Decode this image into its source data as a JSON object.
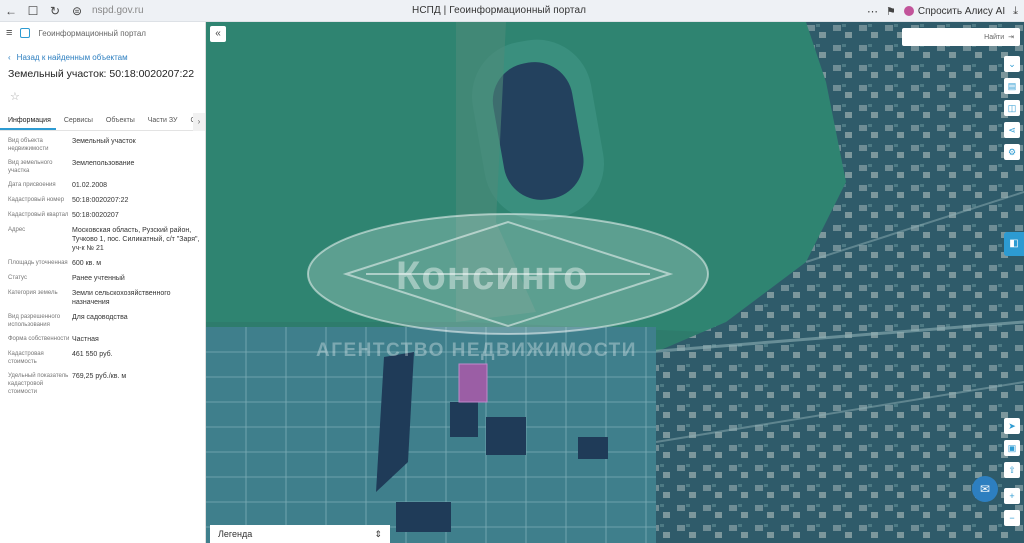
{
  "browser": {
    "url": "nspd.gov.ru",
    "tab_title": "НСПД | Геоинформационный портал",
    "alice_label": "Спросить Алису AI"
  },
  "sidebar": {
    "header": "Геоинформационный портал",
    "back_label": "Назад к найденным объектам",
    "title": "Земельный участок: 50:18:0020207:22",
    "tabs": [
      "Информация",
      "Сервисы",
      "Объекты",
      "Части ЗУ",
      "Соство"
    ],
    "rows": [
      {
        "k": "Вид объекта недвижимости",
        "v": "Земельный участок"
      },
      {
        "k": "Вид земельного участка",
        "v": "Землепользование"
      },
      {
        "k": "Дата присвоения",
        "v": "01.02.2008"
      },
      {
        "k": "Кадастровый номер",
        "v": "50:18:0020207:22"
      },
      {
        "k": "Кадастровый квартал",
        "v": "50:18:0020207"
      },
      {
        "k": "Адрес",
        "v": "Московская область, Рузский район, Тучково 1, пос. Силикатный, с/т \"Заря\", уч-к № 21"
      },
      {
        "k": "Площадь уточненная",
        "v": "600 кв. м"
      },
      {
        "k": "Статус",
        "v": "Ранее учтенный"
      },
      {
        "k": "Категория земель",
        "v": "Земли сельскохозяйственного назначения"
      },
      {
        "k": "Вид разрешенного использования",
        "v": "Для садоводства"
      },
      {
        "k": "Форма собственности",
        "v": "Частная"
      },
      {
        "k": "Кадастровая стоимость",
        "v": "461 550 руб."
      },
      {
        "k": "Удельный показатель кадастровой стоимости",
        "v": "769,25 руб./кв. м"
      }
    ]
  },
  "map": {
    "search_label": "Найти",
    "legend_label": "Легенда",
    "watermark": "Консинго",
    "watermark_sub": "АГЕНТСТВО НЕДВИЖИМОСТИ"
  },
  "colors": {
    "accent": "#2d9bd2",
    "map_overlay": "#3f7f8c",
    "selected_parcel": "#9b5ea5"
  }
}
